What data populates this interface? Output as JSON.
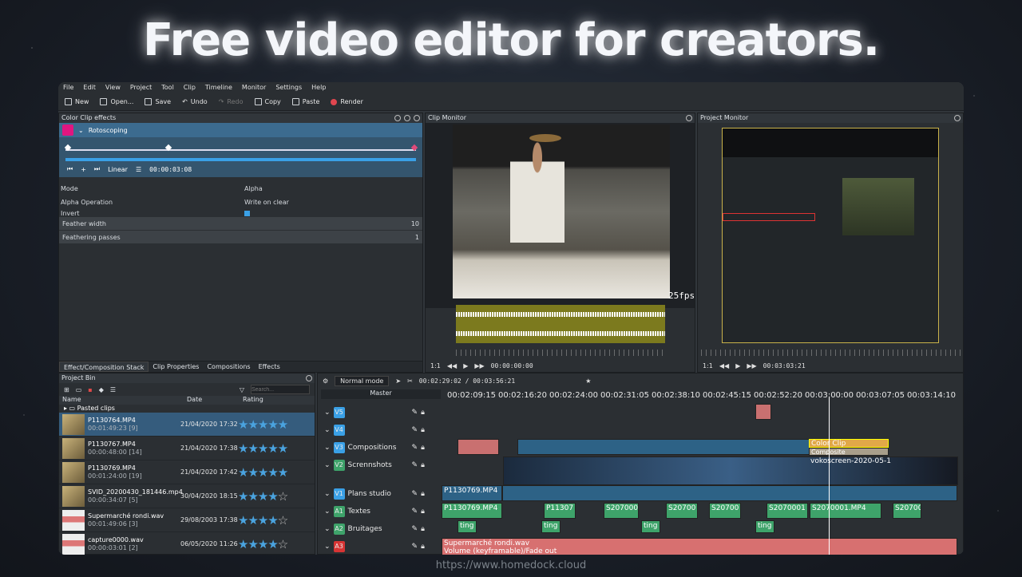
{
  "headline": "Free video editor for creators.",
  "footer_url": "https://www.homedock.cloud",
  "menu": [
    "File",
    "Edit",
    "View",
    "Project",
    "Tool",
    "Clip",
    "Timeline",
    "Monitor",
    "Settings",
    "Help"
  ],
  "toolbar": {
    "new": "New",
    "open": "Open...",
    "save": "Save",
    "undo": "Undo",
    "redo": "Redo",
    "copy": "Copy",
    "paste": "Paste",
    "render": "Render"
  },
  "effects_panel": {
    "title": "Color Clip effects",
    "effect_name": "Rotoscoping",
    "interp": "Linear",
    "timecode": "00:00:03:08",
    "props": [
      {
        "label": "Mode",
        "value": "Alpha"
      },
      {
        "label": "Alpha Operation",
        "value": "Write on clear"
      },
      {
        "label": "Invert",
        "value": ""
      }
    ],
    "sliders": [
      {
        "label": "Feather width",
        "value": "10"
      },
      {
        "label": "Feathering passes",
        "value": "1"
      }
    ],
    "tabs": [
      "Effect/Composition Stack",
      "Clip Properties",
      "Compositions",
      "Effects"
    ]
  },
  "clip_monitor": {
    "title": "Clip Monitor",
    "fps": "25fps",
    "zoom": "1:1",
    "timecode": "00:00:00:00"
  },
  "project_monitor": {
    "title": "Project Monitor",
    "zoom": "1:1",
    "timecode": "00:03:03:21"
  },
  "project_bin": {
    "title": "Project Bin",
    "search_placeholder": "Search...",
    "columns": [
      "Name",
      "Date",
      "Rating"
    ],
    "folder": "Pasted clips",
    "items": [
      {
        "name": "P1130764.MP4",
        "sub": "00:01:49:23 [9]",
        "date": "21/04/2020 17:32",
        "rating": 5
      },
      {
        "name": "P1130767.MP4",
        "sub": "00:00:48:00 [14]",
        "date": "21/04/2020 17:38",
        "rating": 5
      },
      {
        "name": "P1130769.MP4",
        "sub": "00:01:24:00 [19]",
        "date": "21/04/2020 17:42",
        "rating": 5
      },
      {
        "name": "SVID_20200430_181446.mp4",
        "sub": "00:00:34:07 [5]",
        "date": "30/04/2020 18:15",
        "rating": 4
      },
      {
        "name": "Supermarché rondi.wav",
        "sub": "00:01:49:06 [3]",
        "date": "29/08/2003 17:38",
        "rating": 4
      },
      {
        "name": "capture0000.wav",
        "sub": "00:00:03:01 [2]",
        "date": "06/05/2020 11:26",
        "rating": 4
      }
    ]
  },
  "timeline": {
    "mode": "Normal mode",
    "timecode": "00:02:29:02 / 00:03:56:21",
    "master": "Master",
    "ruler": [
      "00:02:09:15",
      "00:02:16:20",
      "00:02:24:00",
      "00:02:31:05",
      "00:02:38:10",
      "00:02:45:15",
      "00:02:52:20",
      "00:03:00:00",
      "00:03:07:05",
      "00:03:14:10"
    ],
    "tracks": [
      {
        "tag": "V5",
        "name": "",
        "kind": "v"
      },
      {
        "tag": "V4",
        "name": "",
        "kind": "v"
      },
      {
        "tag": "V3",
        "name": "Compositions",
        "kind": "v"
      },
      {
        "tag": "V2",
        "name": "Scrennshots",
        "kind": "a"
      },
      {
        "tag": "V1",
        "name": "Plans studio",
        "kind": "v"
      },
      {
        "tag": "A1",
        "name": "Textes",
        "kind": "a"
      },
      {
        "tag": "A2",
        "name": "Bruitages",
        "kind": "a"
      },
      {
        "tag": "A3",
        "name": "",
        "kind": "r"
      }
    ],
    "clip_labels": {
      "color_clip": "Color Clip",
      "composite": "Composite",
      "vokoscreen": "vokoscreen-2020-05-1",
      "v1_clip": "P1130769.MP4",
      "a1_a": "P1130769.MP4",
      "a1_b": "P11307",
      "a1_c": "S207000",
      "a1_d": "S20700",
      "a1_e": "S20700",
      "a1_f": "S2070001",
      "a1_g": "S2070001.MP4",
      "a1_h": "S20700",
      "a2": "ting",
      "a3_name": "Supermarché rondi.wav",
      "a3_sub": "Volume (keyframable)/Fade out"
    }
  },
  "colors": {
    "accent": "#3aa0e6",
    "selection": "#355c7d",
    "effect_header": "#3c6b8f",
    "audio": "#3ea36a",
    "a3": "#d77070"
  }
}
